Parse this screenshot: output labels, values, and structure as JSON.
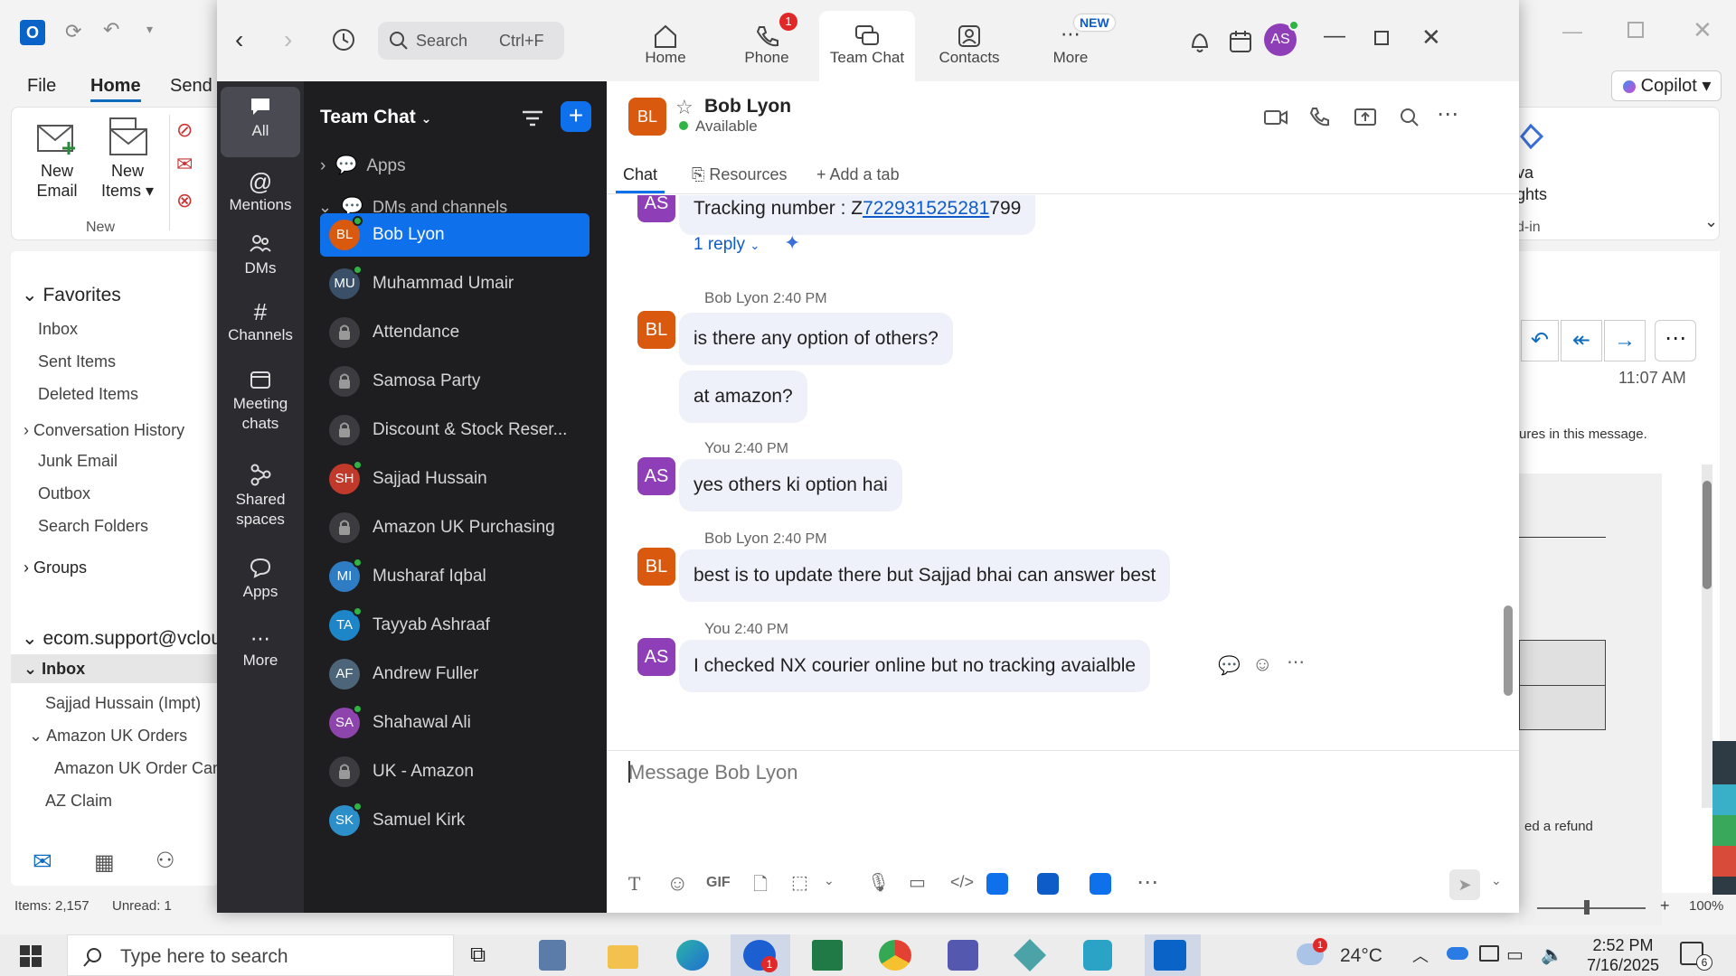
{
  "outlook": {
    "menu": [
      "File",
      "Home",
      "Send /"
    ],
    "ribbon": {
      "new_email": "New Email",
      "new_email_l1": "New",
      "new_email_l2": "Email",
      "new_items_l1": "New",
      "new_items_l2": "Items",
      "group_new": "New",
      "copilot": "Copilot",
      "va": "va",
      "ghts": "ghts",
      "din": "d-in"
    },
    "favorites_header": "Favorites",
    "favorites": [
      "Inbox",
      "Sent Items",
      "Deleted Items",
      "Conversation History",
      "Junk Email",
      "Outbox",
      "Search Folders",
      "Groups"
    ],
    "account": "ecom.support@vclou",
    "inbox": "Inbox",
    "subfolders": [
      "Sajjad Hussain (Impt)",
      "Amazon UK Orders",
      "Amazon UK Order Can",
      "AZ Claim"
    ],
    "status_items": "Items: 2,157",
    "status_unread": "Unread: 1",
    "zoom_level": "100%",
    "reading": {
      "time": "11:07 AM",
      "note": "ures in this message.",
      "refund": "ed a refund"
    }
  },
  "zoom": {
    "search_placeholder": "Search",
    "search_shortcut": "Ctrl+F",
    "tabs": [
      {
        "label": "Home"
      },
      {
        "label": "Phone",
        "badge": "1"
      },
      {
        "label": "Team Chat"
      },
      {
        "label": "Contacts"
      },
      {
        "label": "More",
        "badge": "NEW"
      }
    ],
    "user_initials": "AS",
    "rail": [
      "All",
      "Mentions",
      "DMs",
      "Channels",
      "Meeting chats",
      "Shared spaces",
      "Apps",
      "More"
    ],
    "rail_meeting_l1": "Meeting",
    "rail_meeting_l2": "chats",
    "rail_shared_l1": "Shared",
    "rail_shared_l2": "spaces",
    "panel_title": "Team Chat",
    "apps_label": "Apps",
    "dms_label": "DMs and channels",
    "contacts": [
      {
        "name": "Bob Lyon",
        "initials": "BL",
        "color": "#d9590f",
        "online": true
      },
      {
        "name": "Muhammad Umair",
        "initials": "MU",
        "color": "#3a5068",
        "online": true
      },
      {
        "name": "Attendance",
        "lock": true
      },
      {
        "name": "Samosa Party",
        "lock": true
      },
      {
        "name": "Discount & Stock Reser...",
        "lock": true
      },
      {
        "name": "Sajjad Hussain",
        "initials": "SH",
        "color": "#c0392b",
        "online": true
      },
      {
        "name": "Amazon UK Purchasing",
        "lock": true
      },
      {
        "name": "Musharaf Iqbal",
        "initials": "MI",
        "color": "#2e7cc4",
        "online": true
      },
      {
        "name": "Tayyab Ashraaf",
        "initials": "TA",
        "color": "#1d86c8",
        "online": true
      },
      {
        "name": "Andrew Fuller",
        "initials": "AF",
        "color": "#4d6578",
        "online": false
      },
      {
        "name": "Shahawal Ali",
        "initials": "SA",
        "color": "#8e44ad",
        "online": true
      },
      {
        "name": "UK - Amazon",
        "lock": true
      },
      {
        "name": "Samuel Kirk",
        "initials": "SK",
        "color": "#2c8fc9",
        "online": true
      }
    ],
    "chat": {
      "contact_name": "Bob Lyon",
      "contact_initials": "BL",
      "status": "Available",
      "tabs": [
        "Chat",
        "Resources",
        "+ Add a tab"
      ],
      "tracking_prefix": "Tracking number : Z",
      "tracking_link": "722931525281",
      "tracking_suffix": "799",
      "reply": "1 reply",
      "messages": [
        {
          "sender": "Bob Lyon",
          "time": "2:40 PM",
          "initials": "BL",
          "texts": [
            "is there any option of others?",
            "at amazon?"
          ]
        },
        {
          "sender": "You",
          "time": "2:40 PM",
          "initials": "AS",
          "texts": [
            "yes others ki option hai"
          ]
        },
        {
          "sender": "Bob Lyon",
          "time": "2:40 PM",
          "initials": "BL",
          "texts": [
            "best is to update there but Sajjad bhai can answer best"
          ]
        },
        {
          "sender": "You",
          "time": "2:40 PM",
          "initials": "AS",
          "texts": [
            "I checked NX courier online but no tracking avaialble"
          ]
        }
      ],
      "composer_placeholder": "Message Bob Lyon",
      "gif": "GIF"
    }
  },
  "taskbar": {
    "search_placeholder": "Type here to search",
    "weather": "24°C",
    "weather_badge": "1",
    "time": "2:52 PM",
    "date": "7/16/2025",
    "notif_count": "6",
    "zoom_badge": "1"
  }
}
